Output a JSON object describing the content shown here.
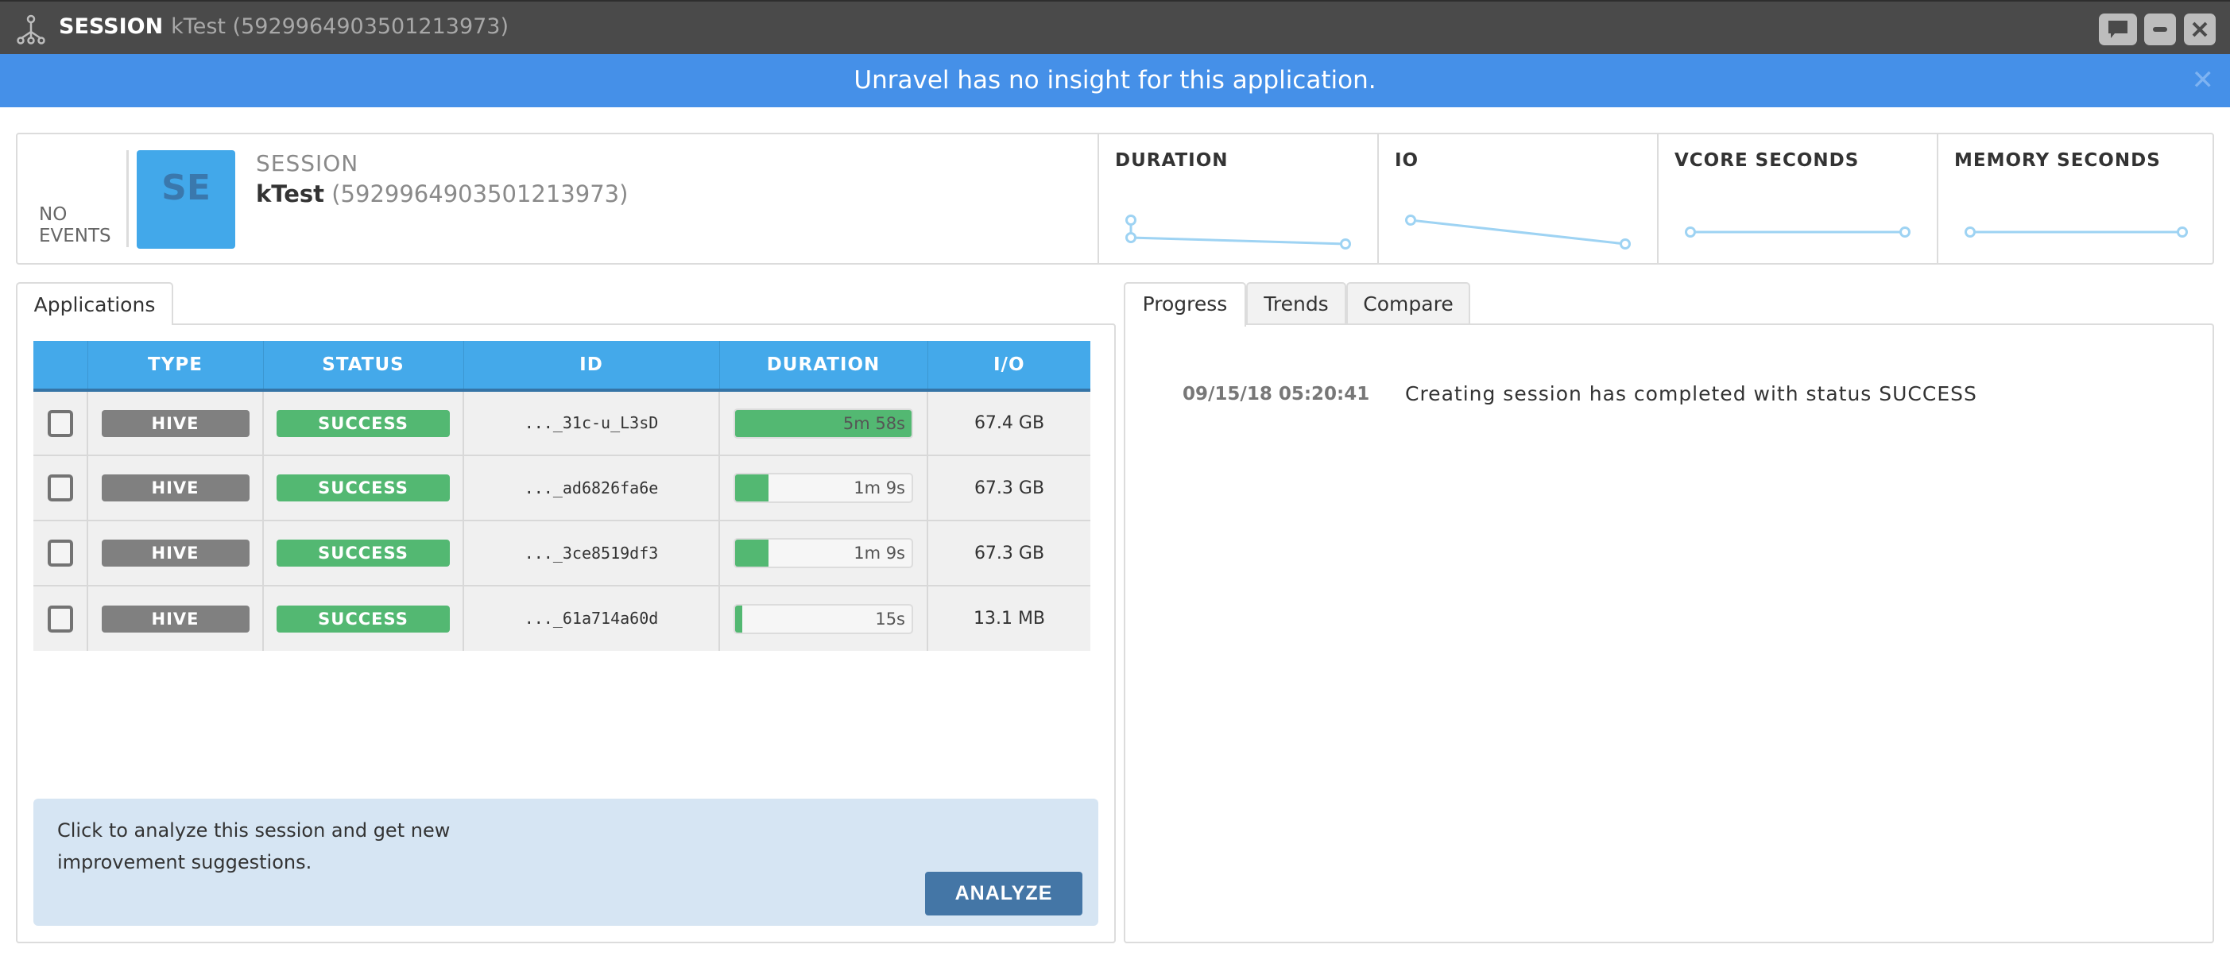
{
  "window": {
    "kind": "SESSION",
    "name": "kTest (5929964903501213973)",
    "buttons": [
      "chat",
      "minimize",
      "close"
    ]
  },
  "banner": {
    "message": "Unravel has no insight for this application.",
    "close_label": "✕",
    "color": "#4590e8"
  },
  "header": {
    "events_label": "NO EVENTS",
    "avatar_initials": "SE",
    "avatar_color": "#42a8ea",
    "kind_label": "SESSION",
    "session_name": "kTest",
    "session_id": "(5929964903501213973)",
    "metrics": [
      {
        "label": "DURATION",
        "sparkline": [
          0.9,
          0.55,
          0.45
        ]
      },
      {
        "label": "IO",
        "sparkline": [
          1.0,
          0.0
        ]
      },
      {
        "label": "VCORE SECONDS",
        "sparkline": [
          0.5,
          0.5
        ]
      },
      {
        "label": "MEMORY SECONDS",
        "sparkline": [
          0.5,
          0.5
        ]
      }
    ]
  },
  "applications": {
    "tab_label": "Applications",
    "columns": [
      "",
      "TYPE",
      "STATUS",
      "ID",
      "DURATION",
      "I/O"
    ],
    "rows": [
      {
        "type": "HIVE",
        "status": "SUCCESS",
        "id": "..._31c-u_L3sD",
        "duration": "5m 58s",
        "duration_fraction": 1.0,
        "io": "67.4 GB"
      },
      {
        "type": "HIVE",
        "status": "SUCCESS",
        "id": "..._ad6826fa6e",
        "duration": "1m 9s",
        "duration_fraction": 0.19,
        "io": "67.3 GB"
      },
      {
        "type": "HIVE",
        "status": "SUCCESS",
        "id": "..._3ce8519df3",
        "duration": "1m 9s",
        "duration_fraction": 0.19,
        "io": "67.3 GB"
      },
      {
        "type": "HIVE",
        "status": "SUCCESS",
        "id": "..._61a714a60d",
        "duration": "15s",
        "duration_fraction": 0.04,
        "io": "13.1 MB"
      }
    ],
    "analyze": {
      "text": "Click to analyze this session and get new improvement suggestions.",
      "button_label": "ANALYZE"
    }
  },
  "right_tabs": {
    "tabs": [
      "Progress",
      "Trends",
      "Compare"
    ],
    "active": "Progress"
  },
  "progress_log": [
    {
      "time": "09/15/18 05:20:41",
      "message": "Creating session has completed with status SUCCESS"
    }
  ],
  "colors": {
    "success": "#53b872",
    "type_badge": "#808080",
    "table_header": "#44a9ea",
    "analyze_button": "#4476a6",
    "sparkline": "#9ed3f3"
  }
}
